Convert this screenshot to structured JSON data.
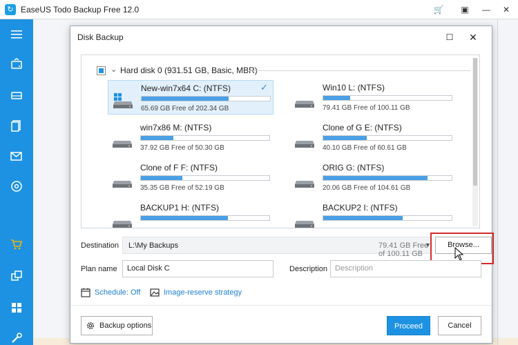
{
  "app": {
    "title": "EaseUS Todo Backup Free 12.0",
    "logo_glyph": "↻",
    "controls": {
      "cart": "🛒",
      "menu": "▣",
      "minimize": "—",
      "close": "✕"
    },
    "accent_color": "#1e92e2"
  },
  "sidebar": {
    "items": [
      "menu-icon",
      "disk-backup-icon",
      "partition-backup-icon",
      "file-backup-icon",
      "mail-backup-icon",
      "smart-backup-icon",
      "cart-icon",
      "clone-icon",
      "apps-icon",
      "tools-icon"
    ]
  },
  "dialog": {
    "title": "Disk Backup",
    "max_glyph": "☐",
    "close_glyph": "✕",
    "hard_disk": {
      "chevron": "⌄",
      "label": "Hard disk 0 (931.51 GB, Basic, MBR)"
    },
    "partitions": [
      {
        "name": "New-win7x64 C: (NTFS)",
        "free": "65.69 GB Free of 202.34 GB",
        "used_fraction": 0.68,
        "selected": true,
        "check": "✓"
      },
      {
        "name": "Win10 L: (NTFS)",
        "free": "79.41 GB Free of 100.11 GB",
        "used_fraction": 0.21
      },
      {
        "name": "win7x86 M: (NTFS)",
        "free": "37.92 GB Free of 50.30 GB",
        "used_fraction": 0.25
      },
      {
        "name": "Clone of G E: (NTFS)",
        "free": "40.10 GB Free of 60.61 GB",
        "used_fraction": 0.34
      },
      {
        "name": "Clone of F F: (NTFS)",
        "free": "35.35 GB Free of 52.19 GB",
        "used_fraction": 0.32
      },
      {
        "name": "ORIG G: (NTFS)",
        "free": "20.06 GB Free of 104.61 GB",
        "used_fraction": 0.81
      },
      {
        "name": "BACKUP1 H: (NTFS)",
        "free": "",
        "used_fraction": 0.68
      },
      {
        "name": "BACKUP2 I: (NTFS)",
        "free": "",
        "used_fraction": 0.62
      }
    ],
    "destination": {
      "label": "Destination",
      "path": "L:\\My Backups",
      "free": "79.41 GB Free of 100.11 GB",
      "arrow": "▼",
      "browse_label": "Browse..."
    },
    "plan": {
      "label": "Plan name",
      "value": "Local Disk C",
      "description_label": "Description",
      "description_placeholder": "Description"
    },
    "schedule_link": "Schedule: Off",
    "image_reserve_link": "Image-reserve strategy",
    "buttons": {
      "options": "Backup options",
      "proceed": "Proceed",
      "cancel": "Cancel"
    }
  }
}
